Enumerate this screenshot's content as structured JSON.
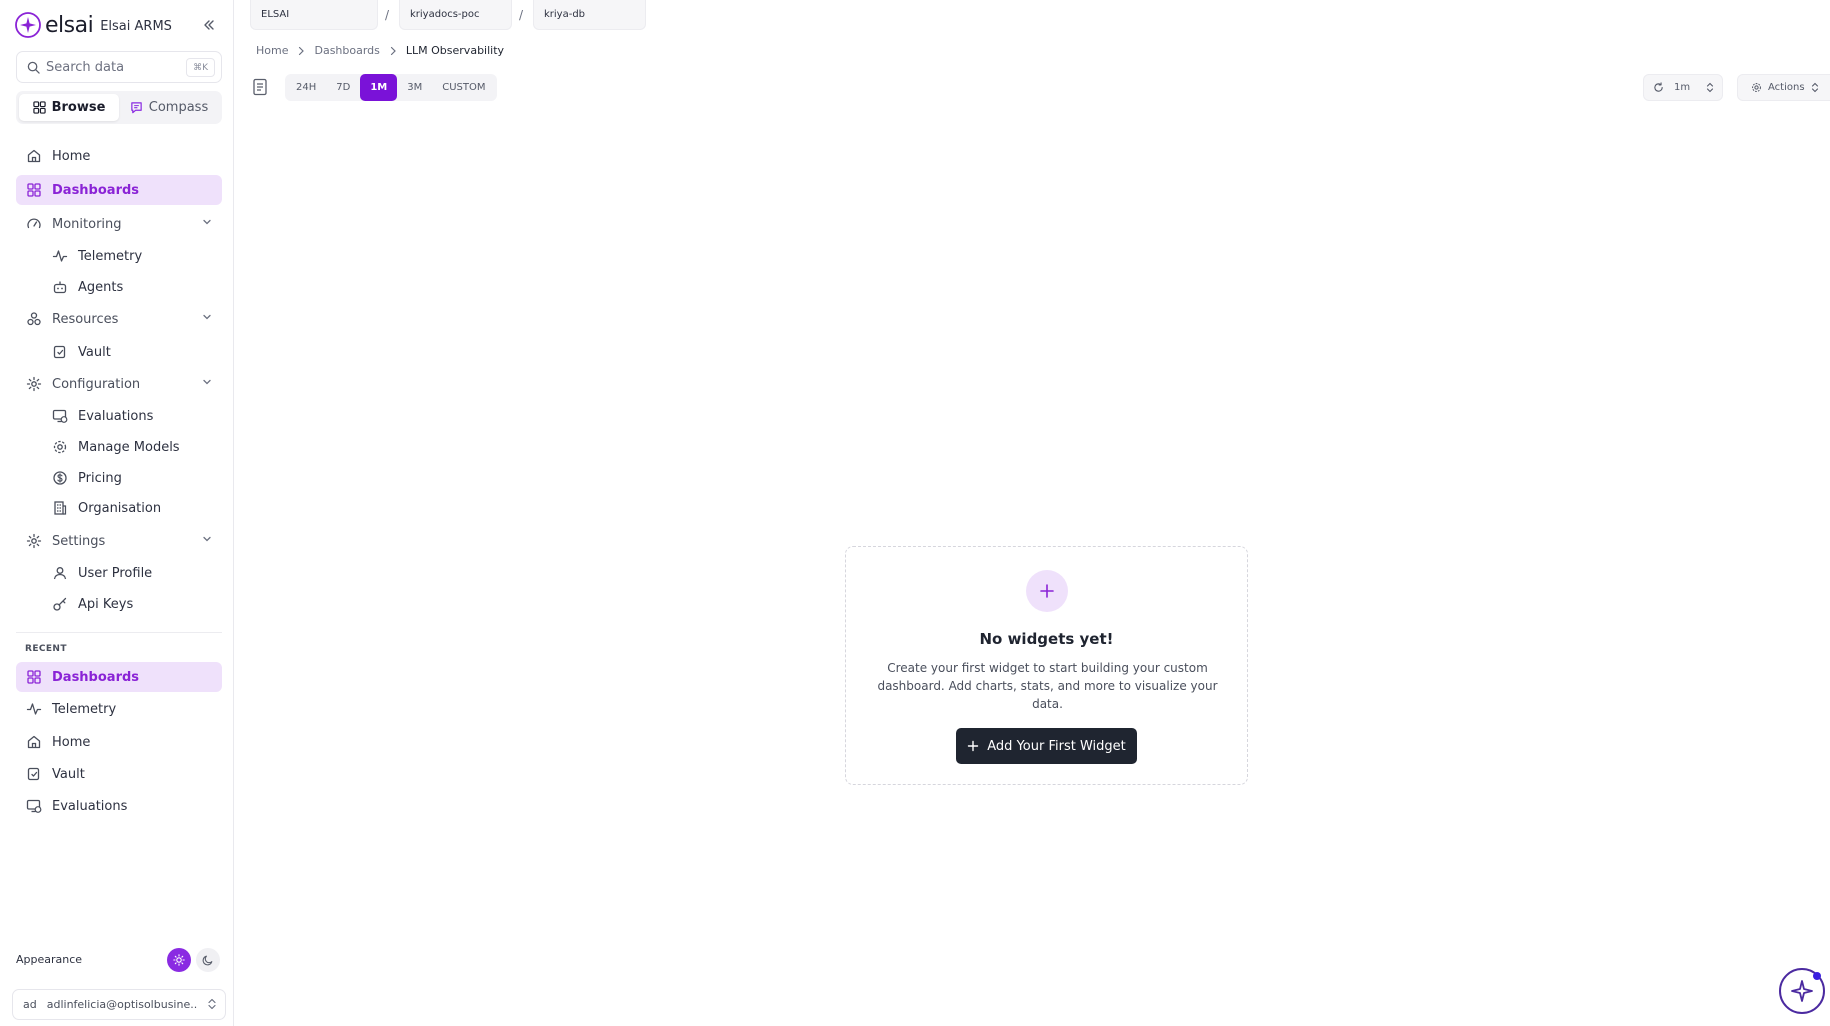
{
  "brand": {
    "wordmark": "elsai",
    "app_name": "Elsai ARMS"
  },
  "search": {
    "placeholder": "Search data",
    "shortcut": "⌘K"
  },
  "mode_switch": {
    "browse": "Browse",
    "compass": "Compass",
    "active": "browse"
  },
  "sidebar": {
    "home": "Home",
    "dashboards": "Dashboards",
    "monitoring": {
      "label": "Monitoring",
      "items": [
        "Telemetry",
        "Agents"
      ]
    },
    "resources": {
      "label": "Resources",
      "items": [
        "Vault"
      ]
    },
    "configuration": {
      "label": "Configuration",
      "items": [
        "Evaluations",
        "Manage Models",
        "Pricing",
        "Organisation"
      ]
    },
    "settings": {
      "label": "Settings",
      "items": [
        "User Profile",
        "Api Keys"
      ]
    },
    "recent_label": "RECENT",
    "recent": [
      "Dashboards",
      "Telemetry",
      "Home",
      "Vault",
      "Evaluations"
    ]
  },
  "appearance": {
    "label": "Appearance",
    "mode": "light"
  },
  "user": {
    "avatar": "ad",
    "email": "adlinfelicia@optisolbusine..."
  },
  "context_tabs": [
    "ELSAI",
    "kriyadocs-poc",
    "kriya-db"
  ],
  "context_separator": "/",
  "breadcrumb": {
    "items": [
      "Home",
      "Dashboards"
    ],
    "current": "LLM Observability"
  },
  "time_ranges": {
    "options": [
      "24H",
      "7D",
      "1M",
      "3M",
      "CUSTOM"
    ],
    "selected": "1M"
  },
  "refresh": {
    "value": "1m"
  },
  "actions": {
    "label": "Actions"
  },
  "empty_state": {
    "title": "No widgets yet!",
    "description": "Create your first widget to start building your custom dashboard. Add charts, stats, and more to visualize your data.",
    "button": "Add Your First Widget"
  },
  "colors": {
    "accent": "#8a23d6",
    "accent_strong": "#7a12d8",
    "active_bg": "#efe1fb",
    "button_dark": "#1f2530"
  }
}
